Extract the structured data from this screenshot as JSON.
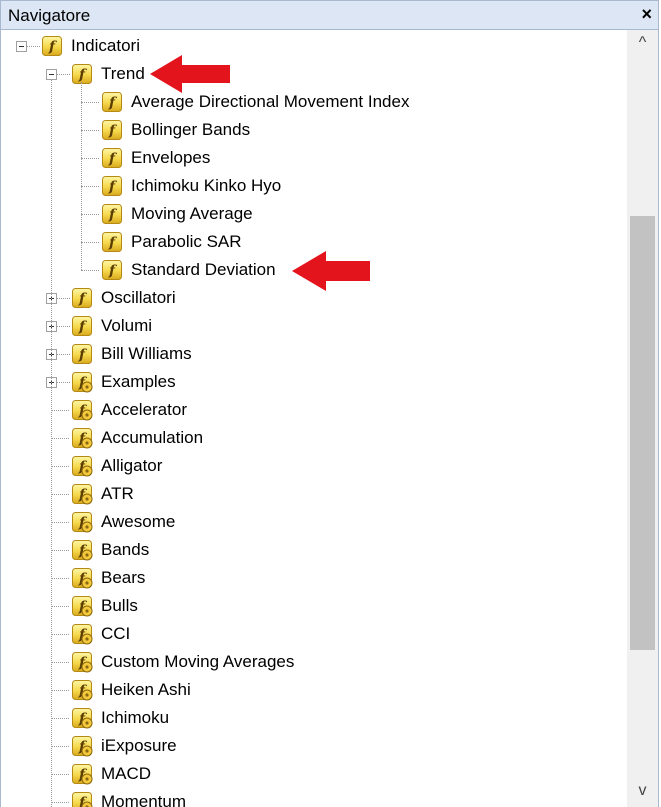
{
  "window": {
    "title": "Navigatore",
    "close_glyph": "×"
  },
  "tree": {
    "root": {
      "label": "Indicatori",
      "expanded": true,
      "icon": "indicator-folder-icon",
      "children": [
        {
          "label": "Trend",
          "expanded": true,
          "icon": "indicator-folder-icon",
          "children": [
            {
              "label": "Average Directional Movement Index",
              "icon": "function-icon"
            },
            {
              "label": "Bollinger Bands",
              "icon": "function-icon"
            },
            {
              "label": "Envelopes",
              "icon": "function-icon"
            },
            {
              "label": "Ichimoku Kinko Hyo",
              "icon": "function-icon"
            },
            {
              "label": "Moving Average",
              "icon": "function-icon"
            },
            {
              "label": "Parabolic SAR",
              "icon": "function-icon"
            },
            {
              "label": "Standard Deviation",
              "icon": "function-icon"
            }
          ]
        },
        {
          "label": "Oscillatori",
          "expanded": false,
          "icon": "indicator-folder-icon"
        },
        {
          "label": "Volumi",
          "expanded": false,
          "icon": "indicator-folder-icon"
        },
        {
          "label": "Bill Williams",
          "expanded": false,
          "icon": "indicator-folder-icon"
        },
        {
          "label": "Examples",
          "expanded": false,
          "icon": "custom-indicator-folder-icon"
        },
        {
          "label": "Accelerator",
          "icon": "custom-indicator-icon"
        },
        {
          "label": "Accumulation",
          "icon": "custom-indicator-icon"
        },
        {
          "label": "Alligator",
          "icon": "custom-indicator-icon"
        },
        {
          "label": "ATR",
          "icon": "custom-indicator-icon"
        },
        {
          "label": "Awesome",
          "icon": "custom-indicator-icon"
        },
        {
          "label": "Bands",
          "icon": "custom-indicator-icon"
        },
        {
          "label": "Bears",
          "icon": "custom-indicator-icon"
        },
        {
          "label": "Bulls",
          "icon": "custom-indicator-icon"
        },
        {
          "label": "CCI",
          "icon": "custom-indicator-icon"
        },
        {
          "label": "Custom Moving Averages",
          "icon": "custom-indicator-icon"
        },
        {
          "label": "Heiken Ashi",
          "icon": "custom-indicator-icon"
        },
        {
          "label": "Ichimoku",
          "icon": "custom-indicator-icon"
        },
        {
          "label": "iExposure",
          "icon": "custom-indicator-icon"
        },
        {
          "label": "MACD",
          "icon": "custom-indicator-icon"
        },
        {
          "label": "Momentum",
          "icon": "custom-indicator-icon"
        }
      ]
    }
  },
  "annotations": {
    "arrow_color": "#e3141c",
    "highlighted_items": [
      "Trend",
      "Standard Deviation"
    ]
  },
  "scrollbar": {
    "up_glyph": "^",
    "down_glyph": "v"
  },
  "colors": {
    "titlebar_bg": "#dce6f4",
    "icon_yellow": "#f7dc4a",
    "icon_border": "#b58a14"
  }
}
